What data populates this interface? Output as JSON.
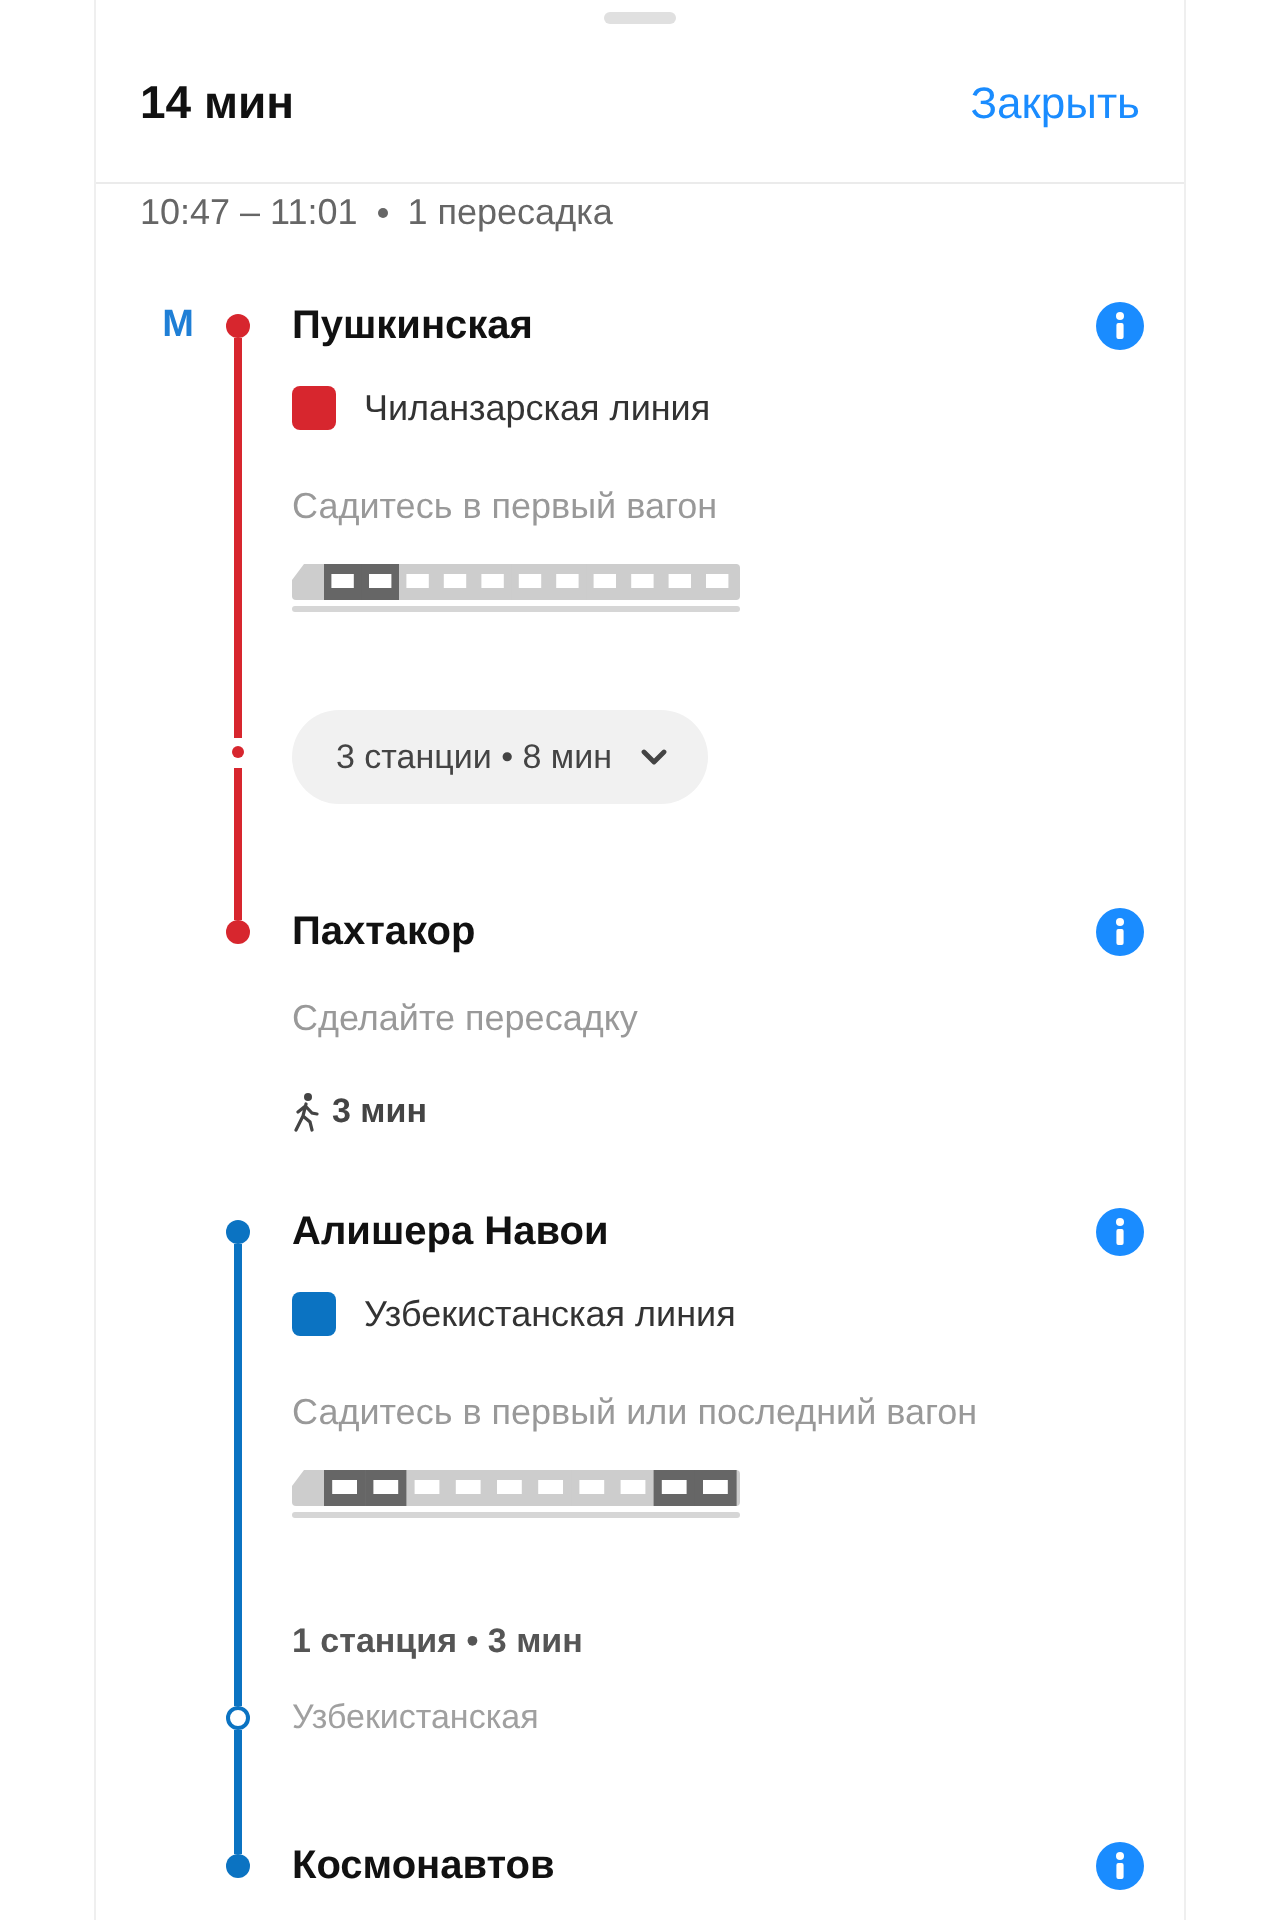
{
  "header": {
    "title": "14 мин",
    "close": "Закрыть"
  },
  "summary": {
    "times": "10:47 – 11:01",
    "transfers": "1 пересадка"
  },
  "legs": [
    {
      "kind": "metro",
      "color": "#d7262e",
      "logo": "М",
      "from": "Пушкинская",
      "line_name": "Чиланзарская линия",
      "hint": "Садитесь в первый вагон",
      "train": [
        {
          "highlighted": true
        },
        {
          "highlighted": true
        },
        {
          "highlighted": false
        },
        {
          "highlighted": false
        },
        {
          "highlighted": false
        },
        {
          "highlighted": false
        },
        {
          "highlighted": false
        },
        {
          "highlighted": false
        },
        {
          "highlighted": false
        },
        {
          "highlighted": false
        },
        {
          "highlighted": false
        }
      ],
      "stops": {
        "summary": "3 станции • 8 мин",
        "expanded": false
      },
      "to": "Пахтакор"
    },
    {
      "kind": "walk",
      "hint": "Сделайте пересадку",
      "duration": "3 мин"
    },
    {
      "kind": "metro",
      "color": "#0b73c2",
      "from": "Алишера Навои",
      "line_name": "Узбекистанская линия",
      "hint": "Садитесь в первый или последний вагон",
      "train": [
        {
          "highlighted": true
        },
        {
          "highlighted": true
        },
        {
          "highlighted": false
        },
        {
          "highlighted": false
        },
        {
          "highlighted": false
        },
        {
          "highlighted": false
        },
        {
          "highlighted": false
        },
        {
          "highlighted": false
        },
        {
          "highlighted": true
        },
        {
          "highlighted": true
        }
      ],
      "stops": {
        "summary": "1 станция • 3 мин",
        "expanded": true,
        "stations": [
          "Узбекистанская"
        ]
      },
      "to": "Космонавтов"
    }
  ]
}
